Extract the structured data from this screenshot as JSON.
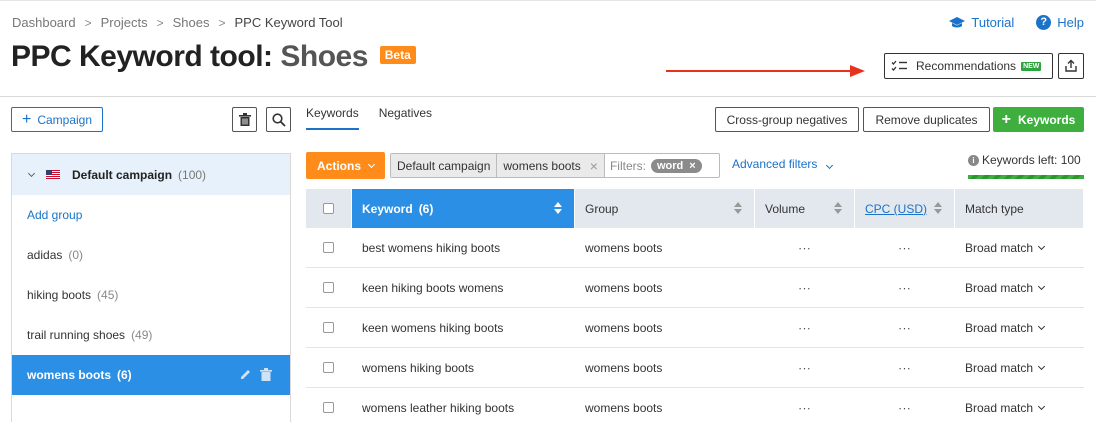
{
  "breadcrumb": [
    "Dashboard",
    "Projects",
    "Shoes",
    "PPC Keyword Tool"
  ],
  "header": {
    "title_tool": "PPC Keyword tool:",
    "title_project": "Shoes",
    "beta": "Beta",
    "tutorial": "Tutorial",
    "help": "Help",
    "recommendations": "Recommendations",
    "new_badge": "NEW"
  },
  "sidebar": {
    "campaign_button": "Campaign",
    "campaign": {
      "name": "Default campaign",
      "count": "(100)"
    },
    "add_group": "Add group",
    "groups": [
      {
        "name": "adidas",
        "count": "(0)"
      },
      {
        "name": "hiking boots",
        "count": "(45)"
      },
      {
        "name": "trail running shoes",
        "count": "(49)"
      },
      {
        "name": "womens boots",
        "count": "(6)"
      }
    ]
  },
  "tabs": [
    "Keywords",
    "Negatives"
  ],
  "toolbar": {
    "cross_group": "Cross-group negatives",
    "remove_duplicates": "Remove duplicates",
    "add_keywords": "Keywords"
  },
  "filters": {
    "actions": "Actions",
    "campaign_chip": "Default campaign",
    "group_chip": "womens boots",
    "filters_label": "Filters:",
    "word_chip": "word",
    "advanced": "Advanced filters",
    "keywords_left": "Keywords left: 100"
  },
  "table": {
    "headers": {
      "keyword": "Keyword",
      "keyword_count": "(6)",
      "group": "Group",
      "volume": "Volume",
      "cpc": "CPC (USD)",
      "match": "Match type"
    },
    "rows": [
      {
        "keyword": "best womens hiking boots",
        "group": "womens boots",
        "volume": "∙∙∙",
        "cpc": "∙∙∙",
        "match": "Broad match"
      },
      {
        "keyword": "keen hiking boots womens",
        "group": "womens boots",
        "volume": "∙∙∙",
        "cpc": "∙∙∙",
        "match": "Broad match"
      },
      {
        "keyword": "keen womens hiking boots",
        "group": "womens boots",
        "volume": "∙∙∙",
        "cpc": "∙∙∙",
        "match": "Broad match"
      },
      {
        "keyword": "womens hiking boots",
        "group": "womens boots",
        "volume": "∙∙∙",
        "cpc": "∙∙∙",
        "match": "Broad match"
      },
      {
        "keyword": "womens leather hiking boots",
        "group": "womens boots",
        "volume": "∙∙∙",
        "cpc": "∙∙∙",
        "match": "Broad match"
      }
    ]
  },
  "colors": {
    "accent": "#1a73c9",
    "orange": "#ff8c1a",
    "green": "#3eaf3e",
    "selected": "#2b8fe6",
    "arrow": "#e8321e"
  }
}
